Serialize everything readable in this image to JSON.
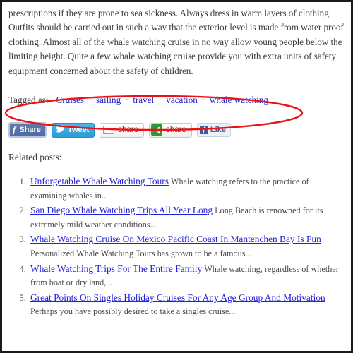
{
  "article": {
    "paragraph": "prescriptions if they are prone to sea sickness. Always dress in warm layers of clothing. Outfits should be carried out in such a way that the exterior level is made from water proof clothing. Almost all of the whale watching cruise in no way allow young people below the limiting height. Quite a few whale watching cruise provide you with extra units of safety equipment concerned about the safety of children."
  },
  "tags": {
    "label": "Tagged as:",
    "separator": "·",
    "items": [
      {
        "label": "Cruises"
      },
      {
        "label": "sailing"
      },
      {
        "label": "travel"
      },
      {
        "label": "vacation"
      },
      {
        "label": "whale watching"
      }
    ]
  },
  "annotation": {
    "shape": "ellipse",
    "color": "#ee1111",
    "target": "tags-row"
  },
  "share_bar": {
    "buttons": [
      {
        "name": "facebook-share",
        "icon": "facebook-f-icon",
        "glyph": "f",
        "label": "Share"
      },
      {
        "name": "twitter-tweet",
        "icon": "twitter-bird-icon",
        "glyph": "🐦",
        "label": "Tweet"
      },
      {
        "name": "email-share",
        "icon": "envelope-icon",
        "glyph": "",
        "label": "share"
      },
      {
        "name": "addthis-share",
        "icon": "share-nodes-icon",
        "glyph": "☰",
        "label": "share"
      },
      {
        "name": "facebook-like",
        "icon": "facebook-f-icon",
        "glyph": "f",
        "label": "Like"
      }
    ],
    "colors": {
      "facebook_blue": "#5b74a8",
      "twitter_blue": "#33a6dd",
      "addthis_green": "#2b9a36",
      "like_bg": "#edeff4"
    }
  },
  "related": {
    "heading": "Related posts:",
    "posts": [
      {
        "number": "1.",
        "title": "Unforgetable Whale Watching Tours",
        "excerpt": "Whale watching refers to the practice of examining whales in..."
      },
      {
        "number": "2.",
        "title": "San Diego Whale Watching Trips All Year Long",
        "excerpt": "Long Beach is renowned for its extremely mild weather conditions..."
      },
      {
        "number": "3.",
        "title": "Whale Watching Cruise On Mexico Pacific Coast In Mantenchen Bay Is Fun",
        "excerpt": "Personalized Whale Watching Tours has grown to be a famous..."
      },
      {
        "number": "4.",
        "title": "Whale Watching Trips For The Entire Family",
        "excerpt": "Whale watching, regardless of whether from boat or dry land,..."
      },
      {
        "number": "5.",
        "title": "Great Points On Singles Holiday Cruises For Any Age Group And Motivation",
        "excerpt": "Perhaps you have possibly desired to take a singles cruise..."
      }
    ]
  },
  "theme": {
    "link_color": "#2222dd",
    "text_color": "#3b3b3b",
    "border_color": "#1a1a1a"
  }
}
